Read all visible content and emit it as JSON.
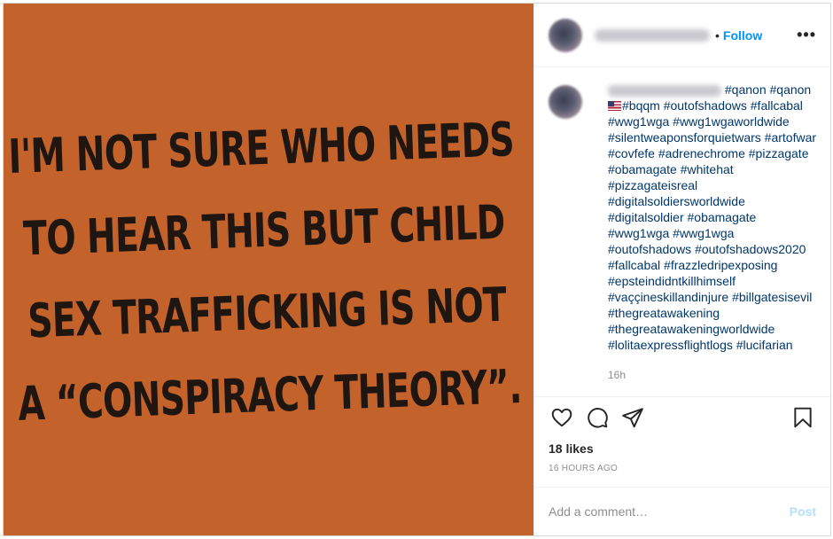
{
  "media": {
    "quote_lines": [
      "I'm not sure who needs",
      "to hear this but child",
      "sex trafficking is not",
      "a “conspiracy theory”."
    ],
    "background_color": "#c4622c"
  },
  "header": {
    "separator": "•",
    "follow_label": "Follow",
    "more_label": "•••"
  },
  "caption": {
    "hashtags_first": "#qanon #qanon",
    "hashtags_rest": "#bqqm #outofshadows #fallcabal #wwg1wga #wwg1wgaworldwide #silentweaponsforquietwars #artofwar #covfefe #adrenechrome #pizzagate #obamagate #whitehat #pizzagateisreal #digitalsoldiersworldwide #digitalsoldier #obamagate #wwg1wga #wwg1wga #outofshadows #outofshadows2020 #fallcabal #frazzledripexposing #epsteindidntkillhimself #vaççineskillandinjure #billgatesisevil #thegreatawakening #thegreatawakeningworldwide #lolitaexpressflightlogs #lucifarian",
    "time": "16h"
  },
  "actions": {
    "icons": [
      "heart-icon",
      "comment-icon",
      "share-icon",
      "bookmark-icon"
    ]
  },
  "likes": "18 likes",
  "posted": "16 HOURS AGO",
  "comment": {
    "placeholder": "Add a comment…",
    "post_label": "Post"
  },
  "colors": {
    "accent": "#0095f6",
    "hashtag": "#00376b",
    "muted": "#8e8e8e"
  }
}
